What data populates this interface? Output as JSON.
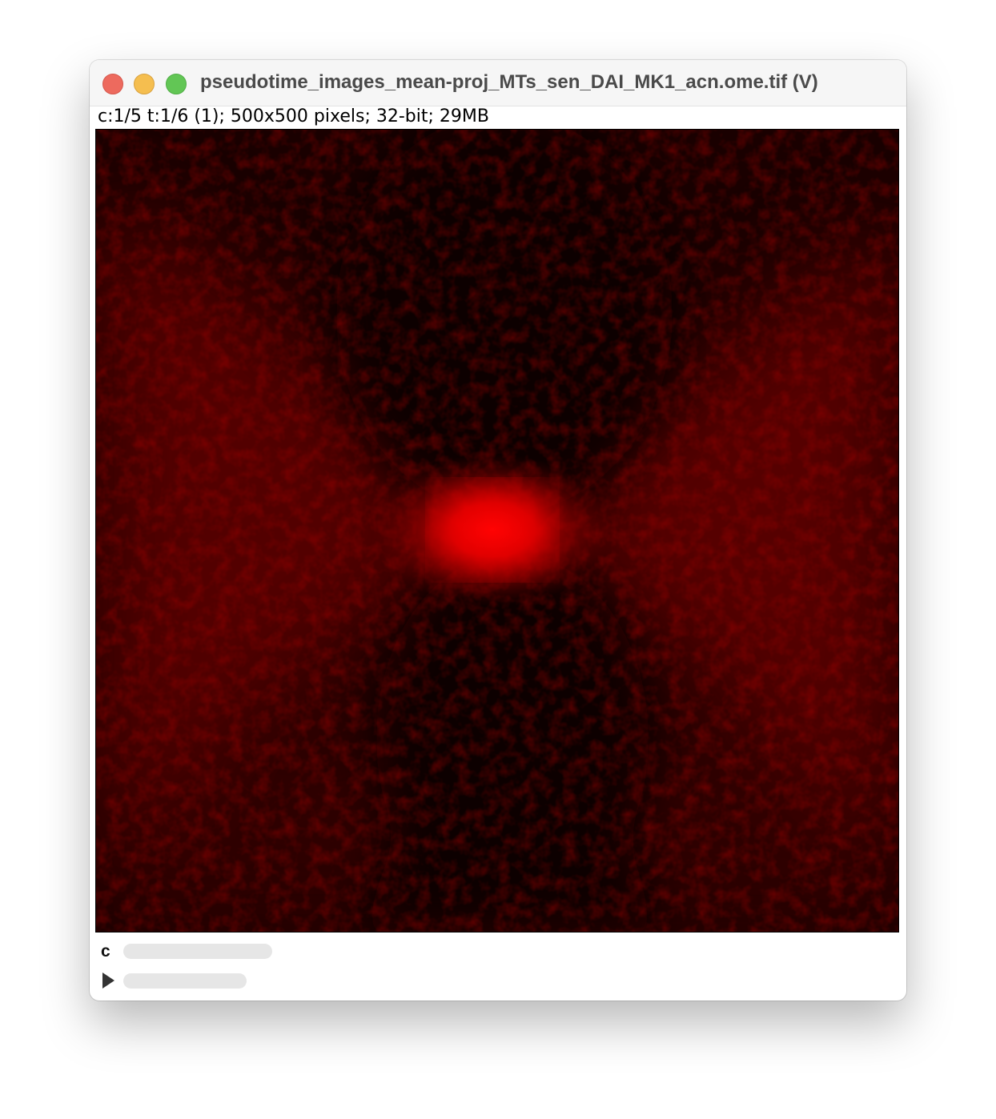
{
  "window": {
    "title": "pseudotime_images_mean-proj_MTs_sen_DAI_MK1_acn.ome.tif (V)",
    "info": "c:1/5 t:1/6 (1); 500x500 pixels; 32-bit; 29MB"
  },
  "sliders": {
    "channel_label": "c",
    "time_play_icon": "play-icon"
  },
  "colors": {
    "lut": "#ff0000",
    "close": "#ed6a5e",
    "minimize": "#f5be4f",
    "maximize": "#62c655"
  }
}
